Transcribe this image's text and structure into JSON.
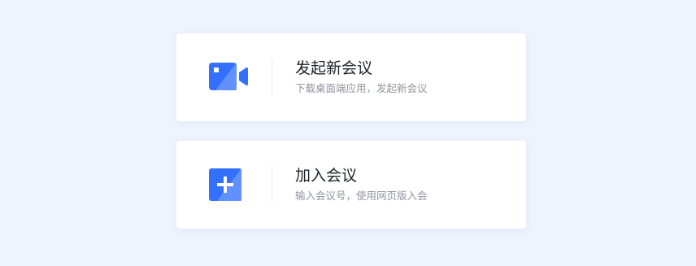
{
  "colors": {
    "background": "#eef3fd",
    "accent": "#3370ff",
    "title_text": "#1f2329",
    "desc_text": "#8f959e"
  },
  "cards": [
    {
      "icon": "video-camera-icon",
      "title": "发起新会议",
      "description": "下载桌面端应用，发起新会议"
    },
    {
      "icon": "plus-icon",
      "title": "加入会议",
      "description": "输入会议号，使用网页版入会"
    }
  ]
}
